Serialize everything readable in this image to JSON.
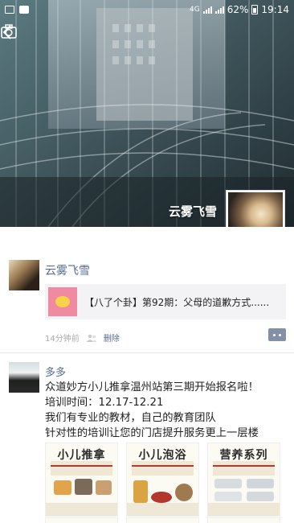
{
  "status_bar": {
    "network": "4G",
    "battery": "62%",
    "time": "19:14"
  },
  "cover": {
    "user_name": "云雾飞雪"
  },
  "posts": [
    {
      "author": "云雾飞雪",
      "shared_title": "【八了个卦】第92期：父母的道歉方式......",
      "time": "14分钟前",
      "delete_label": "删除"
    },
    {
      "author": "多多",
      "text_lines": [
        "众道妙方小儿推拿温州站第三期开始报名啦！",
        "培训时间：12.17-12.21",
        "我们有专业的教材，自己的教育团队",
        "针对性的培训让您的门店提升服务更上一层楼"
      ],
      "image_titles": [
        "小儿推拿",
        "小儿泡浴",
        "营养系列"
      ]
    }
  ],
  "colors": {
    "link": "#576b95",
    "meta": "#aaaaaa"
  }
}
